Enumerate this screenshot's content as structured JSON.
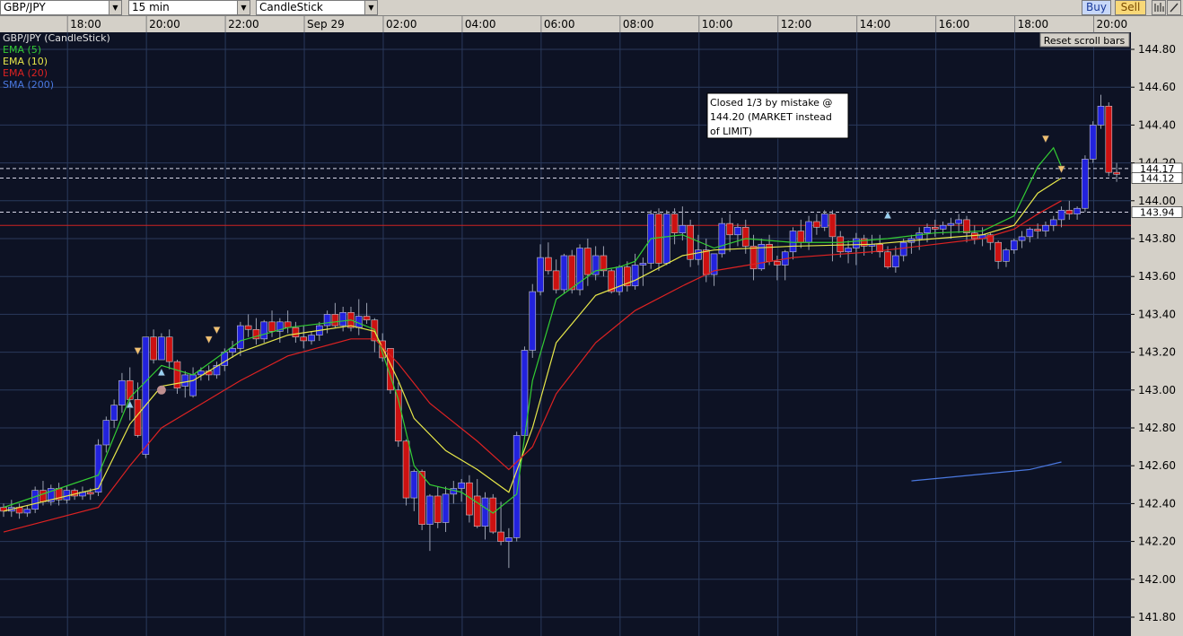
{
  "toolbar": {
    "symbol": "GBP/JPY",
    "timeframe": "15 min",
    "chart_type": "CandleStick",
    "buy_label": "Buy",
    "sell_label": "Sell",
    "icons": [
      "bars-icon",
      "pencil-icon"
    ]
  },
  "legend": {
    "title": "GBP/JPY (CandleStick)",
    "items": [
      {
        "label": "EMA (5)",
        "color": "#33cc33"
      },
      {
        "label": "EMA (10)",
        "color": "#e8e84a"
      },
      {
        "label": "EMA (20)",
        "color": "#dd2222"
      },
      {
        "label": "SMA (200)",
        "color": "#4a78e0"
      }
    ]
  },
  "reset_button": "Reset scroll bars",
  "annotation": {
    "lines": [
      "Closed 1/3 by mistake @",
      "144.20 (MARKET instead",
      "of LIMIT)"
    ]
  },
  "price_labels": [
    {
      "value": 144.17,
      "text": "144.17"
    },
    {
      "value": 144.12,
      "text": "144.12"
    },
    {
      "value": 143.94,
      "text": "143.94"
    }
  ],
  "colors": {
    "background": "#0d1224",
    "grid": "#2a3a5c",
    "bull": "#2222dd",
    "bear": "#cc1111",
    "axis_bg": "#d4d0c8",
    "red_hline": "#cc2222"
  },
  "chart_data": {
    "type": "candlestick",
    "title": "GBP/JPY (CandleStick)",
    "time_ticks": [
      "18:00",
      "20:00",
      "22:00",
      "Sep 29",
      "02:00",
      "04:00",
      "06:00",
      "08:00",
      "10:00",
      "12:00",
      "14:00",
      "16:00",
      "18:00",
      "20:00"
    ],
    "y_ticks": [
      "144.80",
      "144.60",
      "144.40",
      "144.20",
      "144.00",
      "143.80",
      "143.60",
      "143.40",
      "143.20",
      "143.00",
      "142.80",
      "142.60",
      "142.40",
      "142.20",
      "142.00",
      "141.80"
    ],
    "ylim": [
      141.72,
      144.88
    ],
    "grid": true,
    "dashed_levels": [
      144.17,
      144.12,
      143.94
    ],
    "red_level": 143.87,
    "candles": [
      [
        142.38,
        142.4,
        142.33,
        142.36
      ],
      [
        142.36,
        142.42,
        142.33,
        142.38
      ],
      [
        142.38,
        142.4,
        142.32,
        142.35
      ],
      [
        142.35,
        142.39,
        142.33,
        142.37
      ],
      [
        142.37,
        142.49,
        142.35,
        142.47
      ],
      [
        142.47,
        142.52,
        142.39,
        142.41
      ],
      [
        142.41,
        142.5,
        142.39,
        142.48
      ],
      [
        142.48,
        142.51,
        142.39,
        142.42
      ],
      [
        142.42,
        142.49,
        142.4,
        142.47
      ],
      [
        142.47,
        142.48,
        142.42,
        142.44
      ],
      [
        142.44,
        142.49,
        142.42,
        142.46
      ],
      [
        142.46,
        142.48,
        142.42,
        142.45
      ],
      [
        142.46,
        142.74,
        142.44,
        142.71
      ],
      [
        142.71,
        142.86,
        142.67,
        142.84
      ],
      [
        142.84,
        142.95,
        142.8,
        142.92
      ],
      [
        142.92,
        143.09,
        142.88,
        143.05
      ],
      [
        143.05,
        143.12,
        142.84,
        142.95
      ],
      [
        142.95,
        143.04,
        142.75,
        142.76
      ],
      [
        142.66,
        143.28,
        142.64,
        143.28
      ],
      [
        143.28,
        143.32,
        143.14,
        143.16
      ],
      [
        143.16,
        143.3,
        143.16,
        143.28
      ],
      [
        143.28,
        143.32,
        143.11,
        143.15
      ],
      [
        143.15,
        143.16,
        142.98,
        143.01
      ],
      [
        143.02,
        143.1,
        142.96,
        143.08
      ],
      [
        142.97,
        143.12,
        142.96,
        143.08
      ],
      [
        143.08,
        143.12,
        143.05,
        143.1
      ],
      [
        143.1,
        143.13,
        143.05,
        143.08
      ],
      [
        143.08,
        143.15,
        143.06,
        143.13
      ],
      [
        143.13,
        143.22,
        143.1,
        143.2
      ],
      [
        143.2,
        143.26,
        143.17,
        143.22
      ],
      [
        143.22,
        143.36,
        143.18,
        143.34
      ],
      [
        143.34,
        143.4,
        143.28,
        143.32
      ],
      [
        143.32,
        143.38,
        143.24,
        143.27
      ],
      [
        143.27,
        143.37,
        143.25,
        143.36
      ],
      [
        143.36,
        143.42,
        143.28,
        143.31
      ],
      [
        143.31,
        143.38,
        143.25,
        143.36
      ],
      [
        143.36,
        143.42,
        143.3,
        143.33
      ],
      [
        143.33,
        143.36,
        143.25,
        143.28
      ],
      [
        143.28,
        143.34,
        143.22,
        143.26
      ],
      [
        143.26,
        143.31,
        143.24,
        143.29
      ],
      [
        143.29,
        143.36,
        143.26,
        143.34
      ],
      [
        143.34,
        143.42,
        143.3,
        143.4
      ],
      [
        143.4,
        143.46,
        143.33,
        143.34
      ],
      [
        143.34,
        143.44,
        143.31,
        143.41
      ],
      [
        143.41,
        143.44,
        143.31,
        143.33
      ],
      [
        143.33,
        143.48,
        143.29,
        143.39
      ],
      [
        143.39,
        143.46,
        143.35,
        143.37
      ],
      [
        143.37,
        143.38,
        143.2,
        143.26
      ],
      [
        143.26,
        143.3,
        143.15,
        143.17
      ],
      [
        143.22,
        143.22,
        142.98,
        143.0
      ],
      [
        143.0,
        143.04,
        142.7,
        142.73
      ],
      [
        142.73,
        142.74,
        142.39,
        142.43
      ],
      [
        142.43,
        142.58,
        142.36,
        142.57
      ],
      [
        142.57,
        142.58,
        142.26,
        142.29
      ],
      [
        142.29,
        142.45,
        142.15,
        142.44
      ],
      [
        142.44,
        142.49,
        142.27,
        142.3
      ],
      [
        142.3,
        142.49,
        142.25,
        142.45
      ],
      [
        142.45,
        142.52,
        142.4,
        142.48
      ],
      [
        142.48,
        142.53,
        142.41,
        142.51
      ],
      [
        142.51,
        142.55,
        142.3,
        142.34
      ],
      [
        142.44,
        142.53,
        142.27,
        142.28
      ],
      [
        142.28,
        142.46,
        142.21,
        142.43
      ],
      [
        142.43,
        142.45,
        142.24,
        142.25
      ],
      [
        142.25,
        142.41,
        142.18,
        142.2
      ],
      [
        142.2,
        142.27,
        142.06,
        142.22
      ],
      [
        142.22,
        142.78,
        142.2,
        142.76
      ],
      [
        142.76,
        143.23,
        142.74,
        143.21
      ],
      [
        143.21,
        143.56,
        143.17,
        143.52
      ],
      [
        143.52,
        143.77,
        143.5,
        143.7
      ],
      [
        143.7,
        143.78,
        143.61,
        143.63
      ],
      [
        143.63,
        143.69,
        143.51,
        143.53
      ],
      [
        143.53,
        143.72,
        143.51,
        143.71
      ],
      [
        143.71,
        143.74,
        143.51,
        143.53
      ],
      [
        143.53,
        143.77,
        143.5,
        143.75
      ],
      [
        143.75,
        143.8,
        143.55,
        143.61
      ],
      [
        143.61,
        143.76,
        143.58,
        143.71
      ],
      [
        143.71,
        143.76,
        143.6,
        143.63
      ],
      [
        143.63,
        143.64,
        143.51,
        143.52
      ],
      [
        143.52,
        143.66,
        143.5,
        143.65
      ],
      [
        143.65,
        143.68,
        143.52,
        143.55
      ],
      [
        143.55,
        143.72,
        143.53,
        143.66
      ],
      [
        143.66,
        143.7,
        143.55,
        143.67
      ],
      [
        143.67,
        143.95,
        143.64,
        143.93
      ],
      [
        143.93,
        143.96,
        143.63,
        143.67
      ],
      [
        143.67,
        143.95,
        143.66,
        143.93
      ],
      [
        143.93,
        143.96,
        143.77,
        143.83
      ],
      [
        143.83,
        143.97,
        143.79,
        143.87
      ],
      [
        143.87,
        143.9,
        143.65,
        143.69
      ],
      [
        143.69,
        143.82,
        143.66,
        143.74
      ],
      [
        143.74,
        143.8,
        143.57,
        143.61
      ],
      [
        143.61,
        143.72,
        143.55,
        143.72
      ],
      [
        143.72,
        143.91,
        143.7,
        143.88
      ],
      [
        143.88,
        143.93,
        143.73,
        143.82
      ],
      [
        143.82,
        143.88,
        143.76,
        143.86
      ],
      [
        143.86,
        143.9,
        143.72,
        143.76
      ],
      [
        143.76,
        143.82,
        143.58,
        143.64
      ],
      [
        143.64,
        143.8,
        143.63,
        143.77
      ],
      [
        143.77,
        143.82,
        143.66,
        143.68
      ],
      [
        143.68,
        143.71,
        143.58,
        143.66
      ],
      [
        143.66,
        143.74,
        143.58,
        143.73
      ],
      [
        143.73,
        143.86,
        143.69,
        143.84
      ],
      [
        143.84,
        143.9,
        143.75,
        143.78
      ],
      [
        143.78,
        143.92,
        143.74,
        143.89
      ],
      [
        143.89,
        143.93,
        143.82,
        143.86
      ],
      [
        143.86,
        143.95,
        143.84,
        143.93
      ],
      [
        143.93,
        143.95,
        143.68,
        143.81
      ],
      [
        143.81,
        143.84,
        143.7,
        143.73
      ],
      [
        143.73,
        143.79,
        143.67,
        143.75
      ],
      [
        143.75,
        143.83,
        143.66,
        143.8
      ],
      [
        143.8,
        143.82,
        143.71,
        143.76
      ],
      [
        143.76,
        143.82,
        143.72,
        143.77
      ],
      [
        143.77,
        143.82,
        143.7,
        143.73
      ],
      [
        143.73,
        143.76,
        143.64,
        143.65
      ],
      [
        143.65,
        143.76,
        143.62,
        143.71
      ],
      [
        143.71,
        143.8,
        143.68,
        143.78
      ],
      [
        143.78,
        143.82,
        143.72,
        143.8
      ],
      [
        143.8,
        143.86,
        143.74,
        143.83
      ],
      [
        143.83,
        143.88,
        143.78,
        143.86
      ],
      [
        143.86,
        143.9,
        143.81,
        143.85
      ],
      [
        143.85,
        143.89,
        143.82,
        143.87
      ],
      [
        143.87,
        143.91,
        143.8,
        143.88
      ],
      [
        143.88,
        143.93,
        143.83,
        143.9
      ],
      [
        143.9,
        143.92,
        143.78,
        143.83
      ],
      [
        143.83,
        143.87,
        143.77,
        143.8
      ],
      [
        143.8,
        143.86,
        143.76,
        143.82
      ],
      [
        143.82,
        143.83,
        143.74,
        143.78
      ],
      [
        143.78,
        143.79,
        143.64,
        143.68
      ],
      [
        143.68,
        143.75,
        143.65,
        143.74
      ],
      [
        143.74,
        143.8,
        143.72,
        143.79
      ],
      [
        143.79,
        143.84,
        143.75,
        143.81
      ],
      [
        143.81,
        143.86,
        143.78,
        143.85
      ],
      [
        143.85,
        143.88,
        143.8,
        143.84
      ],
      [
        143.84,
        143.89,
        143.81,
        143.87
      ],
      [
        143.87,
        143.92,
        143.84,
        143.9
      ],
      [
        143.9,
        143.97,
        143.86,
        143.95
      ],
      [
        143.95,
        144.0,
        143.9,
        143.93
      ],
      [
        143.93,
        143.97,
        143.9,
        143.96
      ],
      [
        143.96,
        144.24,
        143.94,
        144.22
      ],
      [
        144.22,
        144.42,
        144.2,
        144.4
      ],
      [
        144.4,
        144.56,
        144.38,
        144.5
      ],
      [
        144.5,
        144.52,
        144.13,
        144.15
      ],
      [
        144.15,
        144.2,
        144.1,
        144.14
      ]
    ],
    "series": [
      {
        "name": "EMA (5)",
        "color": "#33cc33",
        "points": [
          [
            0,
            142.38
          ],
          [
            12,
            142.55
          ],
          [
            16,
            142.96
          ],
          [
            20,
            143.13
          ],
          [
            24,
            143.08
          ],
          [
            30,
            143.26
          ],
          [
            36,
            143.33
          ],
          [
            44,
            143.37
          ],
          [
            47,
            143.32
          ],
          [
            50,
            142.95
          ],
          [
            52,
            142.6
          ],
          [
            54,
            142.5
          ],
          [
            58,
            142.46
          ],
          [
            62,
            142.35
          ],
          [
            65,
            142.45
          ],
          [
            67,
            143.05
          ],
          [
            70,
            143.48
          ],
          [
            75,
            143.63
          ],
          [
            78,
            143.65
          ],
          [
            80,
            143.68
          ],
          [
            82,
            143.8
          ],
          [
            86,
            143.82
          ],
          [
            90,
            143.75
          ],
          [
            94,
            143.8
          ],
          [
            100,
            143.78
          ],
          [
            106,
            143.78
          ],
          [
            112,
            143.8
          ],
          [
            118,
            143.83
          ],
          [
            124,
            143.84
          ],
          [
            128,
            143.92
          ],
          [
            131,
            144.18
          ],
          [
            133,
            144.28
          ],
          [
            134,
            144.18
          ]
        ]
      },
      {
        "name": "EMA (10)",
        "color": "#e8e84a",
        "points": [
          [
            0,
            142.36
          ],
          [
            12,
            142.48
          ],
          [
            16,
            142.82
          ],
          [
            20,
            143.02
          ],
          [
            24,
            143.05
          ],
          [
            30,
            143.2
          ],
          [
            36,
            143.29
          ],
          [
            44,
            143.34
          ],
          [
            47,
            143.31
          ],
          [
            50,
            143.05
          ],
          [
            52,
            142.85
          ],
          [
            56,
            142.68
          ],
          [
            60,
            142.58
          ],
          [
            64,
            142.46
          ],
          [
            67,
            142.8
          ],
          [
            70,
            143.25
          ],
          [
            75,
            143.5
          ],
          [
            80,
            143.58
          ],
          [
            86,
            143.71
          ],
          [
            90,
            143.74
          ],
          [
            100,
            143.76
          ],
          [
            110,
            143.77
          ],
          [
            118,
            143.8
          ],
          [
            124,
            143.82
          ],
          [
            128,
            143.87
          ],
          [
            131,
            144.04
          ],
          [
            134,
            144.12
          ]
        ]
      },
      {
        "name": "EMA (20)",
        "color": "#dd2222",
        "points": [
          [
            0,
            142.25
          ],
          [
            12,
            142.38
          ],
          [
            16,
            142.6
          ],
          [
            20,
            142.8
          ],
          [
            24,
            142.9
          ],
          [
            30,
            143.05
          ],
          [
            36,
            143.18
          ],
          [
            44,
            143.27
          ],
          [
            47,
            143.27
          ],
          [
            50,
            143.14
          ],
          [
            54,
            142.93
          ],
          [
            60,
            142.73
          ],
          [
            64,
            142.58
          ],
          [
            67,
            142.7
          ],
          [
            70,
            142.98
          ],
          [
            75,
            143.25
          ],
          [
            80,
            143.42
          ],
          [
            86,
            143.55
          ],
          [
            90,
            143.63
          ],
          [
            100,
            143.7
          ],
          [
            110,
            143.73
          ],
          [
            118,
            143.77
          ],
          [
            124,
            143.8
          ],
          [
            128,
            143.85
          ],
          [
            131,
            143.93
          ],
          [
            134,
            144.0
          ]
        ]
      },
      {
        "name": "SMA (200)",
        "color": "#4a78e0",
        "points": [
          [
            115,
            142.52
          ],
          [
            120,
            142.54
          ],
          [
            125,
            142.56
          ],
          [
            130,
            142.58
          ],
          [
            134,
            142.62
          ]
        ]
      }
    ],
    "markers": [
      {
        "i": 16,
        "price": 142.92,
        "dir": "up"
      },
      {
        "i": 17,
        "price": 143.21,
        "dir": "down"
      },
      {
        "i": 20,
        "price": 143.09,
        "dir": "up"
      },
      {
        "i": 20,
        "price": 143.0,
        "dir": "dot"
      },
      {
        "i": 26,
        "price": 143.27,
        "dir": "down"
      },
      {
        "i": 27,
        "price": 143.32,
        "dir": "down"
      },
      {
        "i": 112,
        "price": 143.92,
        "dir": "up"
      },
      {
        "i": 132,
        "price": 144.33,
        "dir": "down"
      },
      {
        "i": 134,
        "price": 144.17,
        "dir": "down"
      }
    ]
  }
}
